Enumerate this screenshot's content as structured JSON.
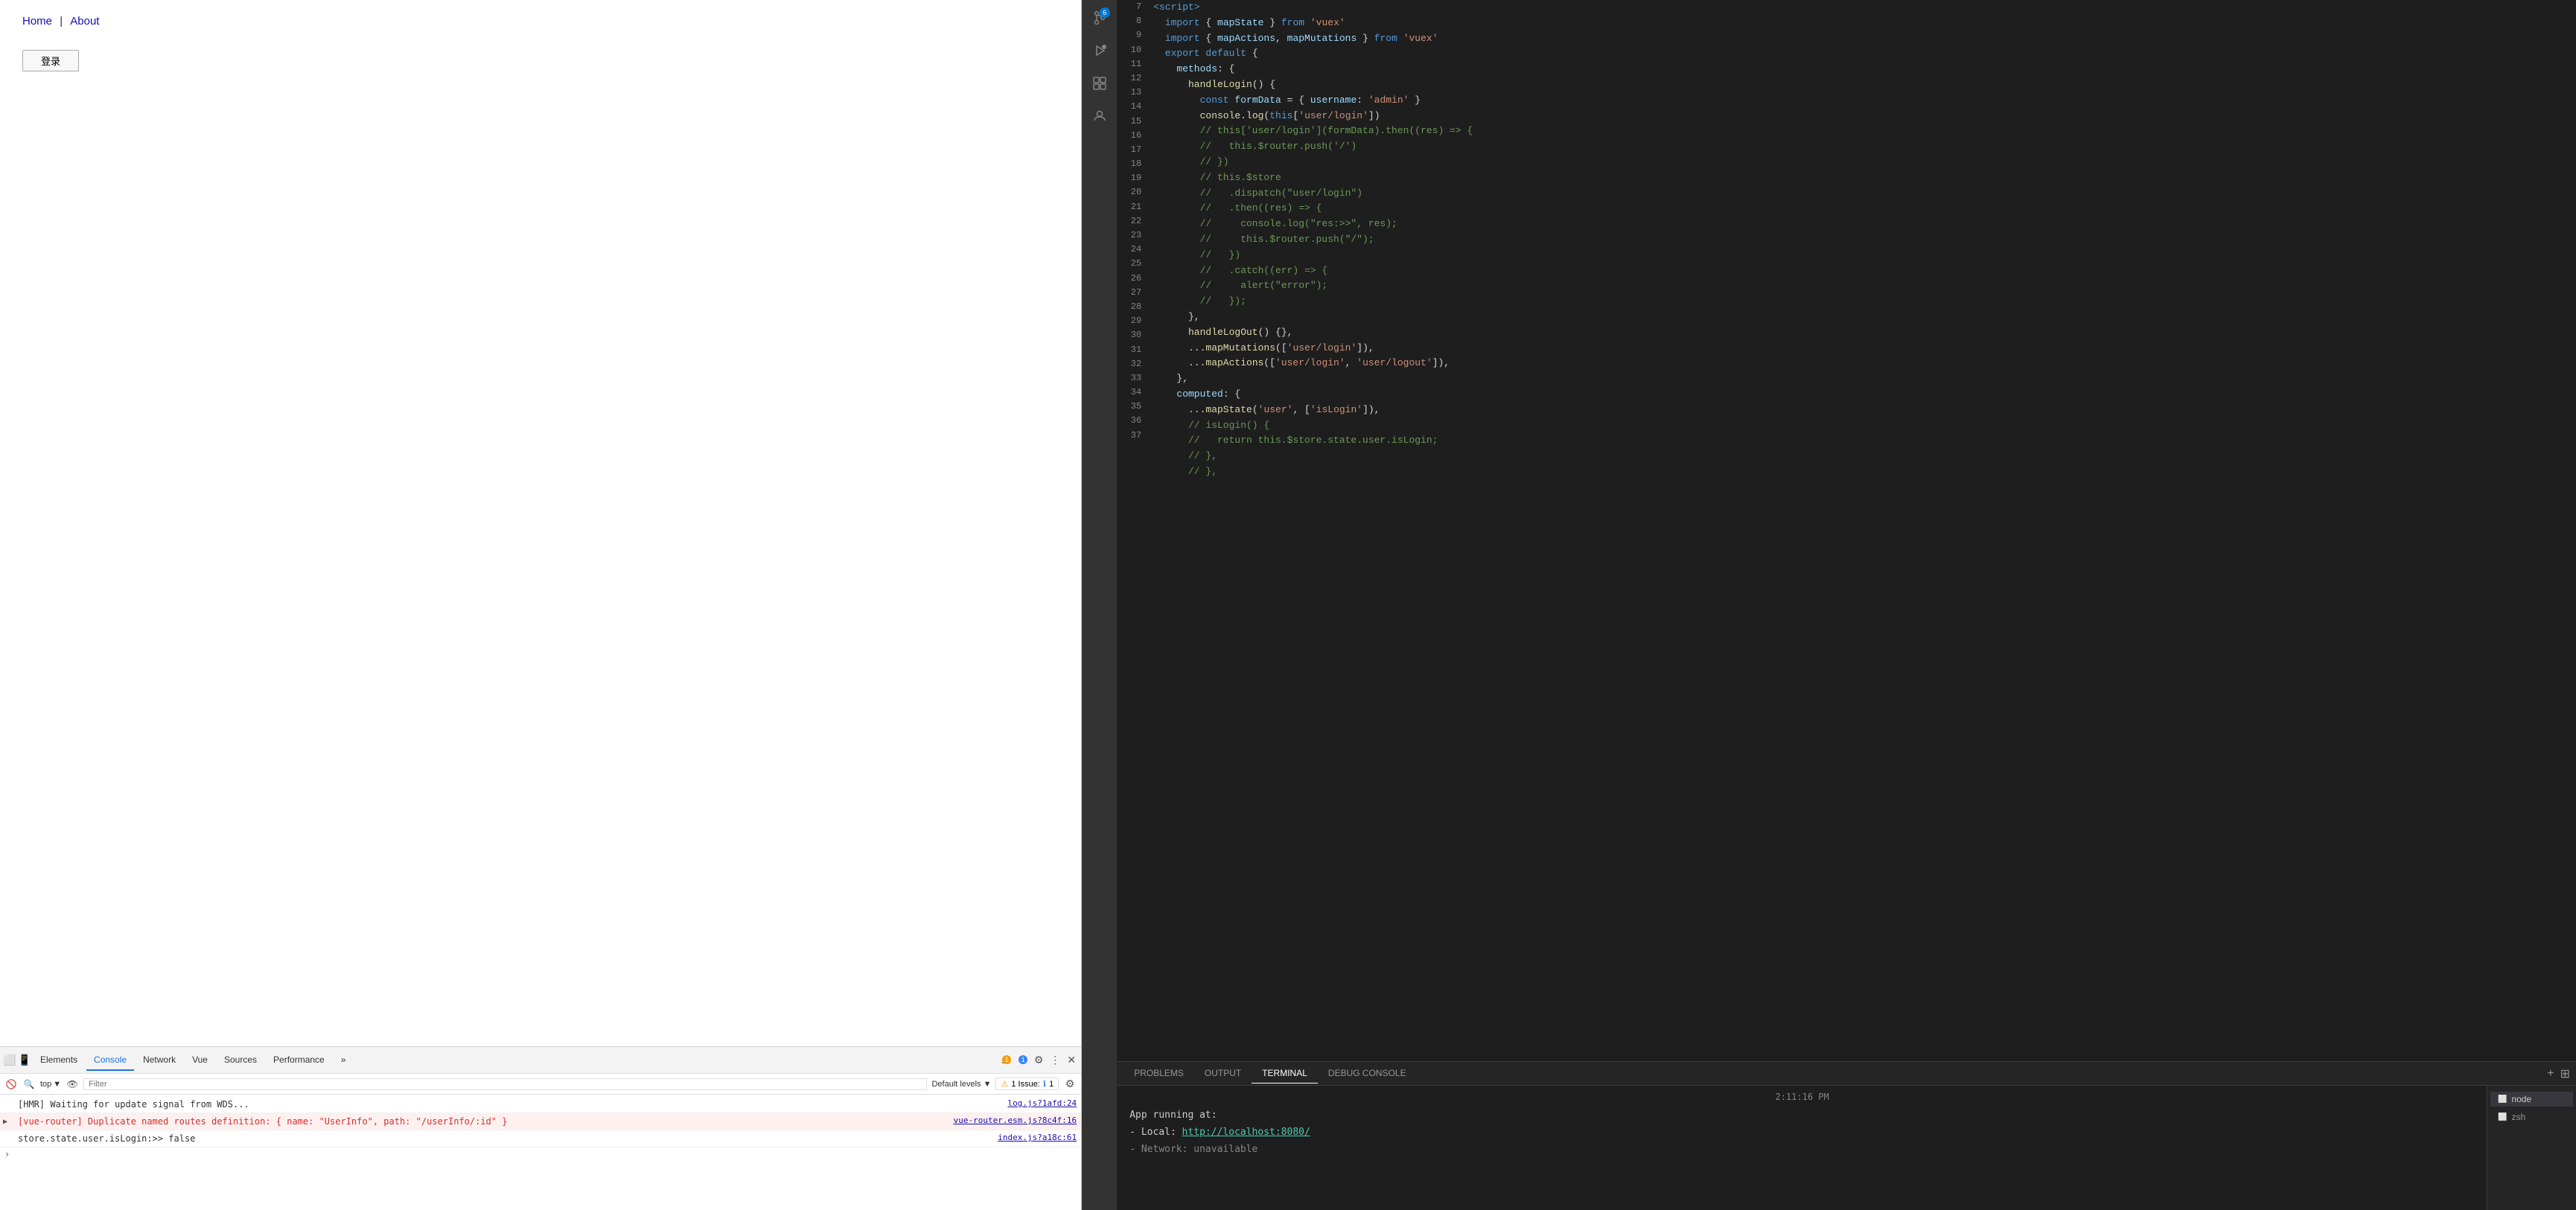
{
  "browser": {
    "nav_links": [
      {
        "label": "Home",
        "href": "#"
      },
      {
        "label": "About",
        "href": "#"
      }
    ],
    "separator": "|",
    "login_button": "登录"
  },
  "devtools": {
    "tabs": [
      {
        "label": "Elements",
        "active": false
      },
      {
        "label": "Console",
        "active": true
      },
      {
        "label": "Network",
        "active": false
      },
      {
        "label": "Vue",
        "active": false
      },
      {
        "label": "Sources",
        "active": false
      },
      {
        "label": "Performance",
        "active": false
      }
    ],
    "more_tabs_label": "»",
    "warn_count": "1",
    "info_count": "1",
    "filter_placeholder": "Filter",
    "default_levels_label": "Default levels ▼",
    "issue_label": "1 Issue:",
    "issue_count": "1",
    "console_lines": [
      {
        "type": "hmr",
        "text": "[HMR] Waiting for update signal from WDS...",
        "link": "log.js?1afd:24"
      },
      {
        "type": "error",
        "icon": "▶",
        "text": "[vue-router] Duplicate named routes definition: { name: \"UserInfo\", path: \"/userInfo/:id\" }",
        "link": "vue-router.esm.js?8c4f:16"
      },
      {
        "type": "log",
        "text": "store.state.user.isLogin:>> false",
        "link": "index.js?a18c:61"
      }
    ],
    "top_context": "top"
  },
  "editor": {
    "sidebar_icons": [
      {
        "name": "source-control",
        "symbol": "⑂",
        "badge": "6"
      },
      {
        "name": "run-debug",
        "symbol": "▷"
      },
      {
        "name": "extensions",
        "symbol": "⊞"
      },
      {
        "name": "accounts",
        "symbol": "♟"
      }
    ],
    "code_lines": [
      {
        "num": 7,
        "tokens": [
          {
            "t": "tag",
            "v": "  <script>"
          }
        ]
      },
      {
        "num": 8,
        "tokens": [
          {
            "t": "keyword",
            "v": "  import"
          },
          {
            "t": "light",
            "v": " { "
          },
          {
            "t": "prop",
            "v": "mapState"
          },
          {
            "t": "light",
            "v": " } "
          },
          {
            "t": "keyword",
            "v": "from"
          },
          {
            "t": "string",
            "v": " 'vuex'"
          }
        ]
      },
      {
        "num": 9,
        "tokens": [
          {
            "t": "keyword",
            "v": "  import"
          },
          {
            "t": "light",
            "v": " { "
          },
          {
            "t": "prop",
            "v": "mapActions"
          },
          {
            "t": "light",
            "v": ", "
          },
          {
            "t": "prop",
            "v": "mapMutations"
          },
          {
            "t": "light",
            "v": " } "
          },
          {
            "t": "keyword",
            "v": "from"
          },
          {
            "t": "string",
            "v": " 'vuex'"
          }
        ]
      },
      {
        "num": 10,
        "tokens": [
          {
            "t": "keyword",
            "v": "  export"
          },
          {
            "t": "keyword",
            "v": " default"
          },
          {
            "t": "light",
            "v": " {"
          }
        ]
      },
      {
        "num": 11,
        "tokens": [
          {
            "t": "prop",
            "v": "    methods"
          },
          {
            "t": "light",
            "v": ": {"
          }
        ]
      },
      {
        "num": 12,
        "tokens": [
          {
            "t": "func",
            "v": "      handleLogin"
          },
          {
            "t": "light",
            "v": "() {"
          }
        ]
      },
      {
        "num": 13,
        "tokens": [
          {
            "t": "keyword",
            "v": "        const"
          },
          {
            "t": "prop",
            "v": " formData"
          },
          {
            "t": "light",
            "v": " = { "
          },
          {
            "t": "prop",
            "v": "username"
          },
          {
            "t": "light",
            "v": ": "
          },
          {
            "t": "string",
            "v": "'admin'"
          },
          {
            "t": "light",
            "v": " }"
          }
        ]
      },
      {
        "num": 14,
        "tokens": [
          {
            "t": "method",
            "v": "        console"
          },
          {
            "t": "light",
            "v": "."
          },
          {
            "t": "method",
            "v": "log"
          },
          {
            "t": "light",
            "v": "("
          },
          {
            "t": "keyword",
            "v": "this"
          },
          {
            "t": "light",
            "v": "["
          },
          {
            "t": "string",
            "v": "'user/login'"
          },
          {
            "t": "light",
            "v": "])"
          }
        ]
      },
      {
        "num": 15,
        "tokens": [
          {
            "t": "comment",
            "v": "        // this['user/login'](formData).then((res) => {"
          }
        ]
      },
      {
        "num": 16,
        "tokens": [
          {
            "t": "comment",
            "v": "        //   this.$router.push('/')"
          }
        ]
      },
      {
        "num": 17,
        "tokens": [
          {
            "t": "comment",
            "v": "        // })"
          }
        ]
      },
      {
        "num": 18,
        "tokens": [
          {
            "t": "comment",
            "v": "        // this.$store"
          }
        ]
      },
      {
        "num": 19,
        "tokens": [
          {
            "t": "comment",
            "v": "        //   .dispatch(\"user/login\")"
          }
        ]
      },
      {
        "num": 20,
        "tokens": [
          {
            "t": "comment",
            "v": "        //   .then((res) => {"
          }
        ]
      },
      {
        "num": 21,
        "tokens": [
          {
            "t": "comment",
            "v": "        //     console.log(\"res:>>\", res);"
          }
        ]
      },
      {
        "num": 22,
        "tokens": [
          {
            "t": "comment",
            "v": "        //     this.$router.push(\"/\");"
          }
        ]
      },
      {
        "num": 23,
        "tokens": [
          {
            "t": "comment",
            "v": "        //   })"
          }
        ]
      },
      {
        "num": 24,
        "tokens": [
          {
            "t": "comment",
            "v": "        //   .catch((err) => {"
          }
        ]
      },
      {
        "num": 25,
        "tokens": [
          {
            "t": "comment",
            "v": "        //     alert(\"error\");"
          }
        ]
      },
      {
        "num": 26,
        "tokens": [
          {
            "t": "comment",
            "v": "        //   });"
          }
        ]
      },
      {
        "num": 27,
        "tokens": [
          {
            "t": "light",
            "v": "      },"
          }
        ]
      },
      {
        "num": 28,
        "tokens": [
          {
            "t": "func",
            "v": "      handleLogOut"
          },
          {
            "t": "light",
            "v": "() {},"
          }
        ]
      },
      {
        "num": 29,
        "tokens": [
          {
            "t": "spread",
            "v": "      ..."
          },
          {
            "t": "method",
            "v": "mapMutations"
          },
          {
            "t": "light",
            "v": "(["
          },
          {
            "t": "string",
            "v": "'user/login'"
          },
          {
            "t": "light",
            "v": "]),"
          }
        ]
      },
      {
        "num": 30,
        "tokens": [
          {
            "t": "spread",
            "v": "      ..."
          },
          {
            "t": "method",
            "v": "mapActions"
          },
          {
            "t": "light",
            "v": "(["
          },
          {
            "t": "string",
            "v": "'user/login'"
          },
          {
            "t": "light",
            "v": ", "
          },
          {
            "t": "string",
            "v": "'user/logout'"
          },
          {
            "t": "light",
            "v": "]),"
          }
        ]
      },
      {
        "num": 31,
        "tokens": [
          {
            "t": "light",
            "v": "    },"
          }
        ]
      },
      {
        "num": 32,
        "tokens": [
          {
            "t": "prop",
            "v": "    computed"
          },
          {
            "t": "light",
            "v": ": {"
          }
        ]
      },
      {
        "num": 33,
        "tokens": [
          {
            "t": "spread",
            "v": "      ..."
          },
          {
            "t": "method",
            "v": "mapState"
          },
          {
            "t": "light",
            "v": "("
          },
          {
            "t": "string",
            "v": "'user'"
          },
          {
            "t": "light",
            "v": ", ["
          },
          {
            "t": "string",
            "v": "'isLogin'"
          },
          {
            "t": "light",
            "v": "]),"
          }
        ]
      },
      {
        "num": 34,
        "tokens": [
          {
            "t": "comment",
            "v": "      // isLogin() {"
          }
        ]
      },
      {
        "num": 35,
        "tokens": [
          {
            "t": "comment",
            "v": "      //   return this.$store.state.user.isLogin;"
          }
        ]
      },
      {
        "num": 36,
        "tokens": [
          {
            "t": "comment",
            "v": "      // },"
          }
        ]
      }
    ]
  },
  "terminal": {
    "tabs": [
      {
        "label": "PROBLEMS",
        "active": false
      },
      {
        "label": "OUTPUT",
        "active": false
      },
      {
        "label": "TERMINAL",
        "active": true
      },
      {
        "label": "DEBUG CONSOLE",
        "active": false
      }
    ],
    "timestamp": "2:11:16 PM",
    "lines": [
      {
        "text": "App running at:",
        "type": "label"
      },
      {
        "prefix": "- Local:",
        "link": "http://localhost:8080/",
        "type": "link"
      },
      {
        "text": "- Network:  unavailable",
        "type": "dim"
      }
    ],
    "sessions": [
      "node",
      "zsh"
    ],
    "add_icon": "+",
    "split_icon": "⊞"
  }
}
